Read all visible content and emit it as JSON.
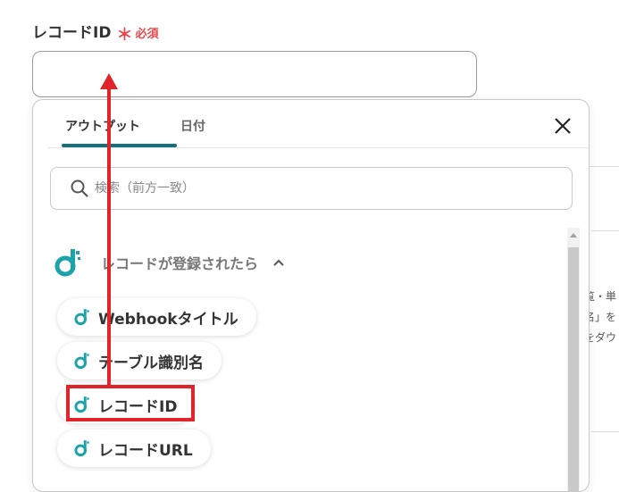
{
  "field": {
    "label": "レコードID",
    "required_mark": "＊",
    "required_label": "必須",
    "value": "",
    "placeholder": ""
  },
  "background_text": [
    "覧・単",
    "名」を",
    "をダウ"
  ],
  "dropdown": {
    "tabs": [
      {
        "label": "アウトプット",
        "active": true
      },
      {
        "label": "日付",
        "active": false
      }
    ],
    "close_icon": "close-icon",
    "search": {
      "placeholder": "検索（前方一致）",
      "value": ""
    },
    "group": {
      "title": "レコードが登録されたら",
      "expanded": true,
      "icon": "app-logo-icon"
    },
    "items": [
      {
        "label": "Webhookタイトル"
      },
      {
        "label": "テーブル識別名"
      },
      {
        "label": "レコードID",
        "highlighted": true
      },
      {
        "label": "レコードURL"
      }
    ]
  },
  "colors": {
    "accent": "#14707a",
    "logo": "#1aa3a8",
    "required": "#e5484d",
    "annotation": "#e0242a"
  }
}
